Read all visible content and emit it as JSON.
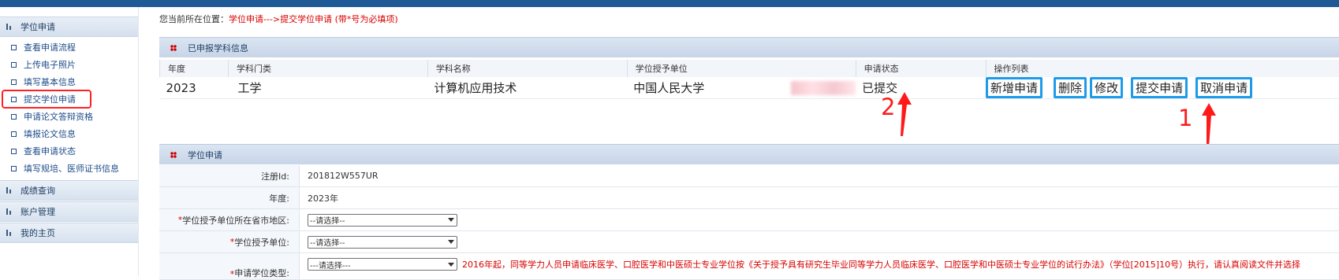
{
  "sidebar": {
    "header": "学位申请",
    "items": [
      {
        "label": "查看申请流程"
      },
      {
        "label": "上传电子照片"
      },
      {
        "label": "填写基本信息"
      },
      {
        "label": "提交学位申请"
      },
      {
        "label": "申请论文答辩资格"
      },
      {
        "label": "填报论文信息"
      },
      {
        "label": "查看申请状态"
      },
      {
        "label": "填写规培、医师证书信息"
      }
    ],
    "sections": [
      {
        "label": "成绩查询"
      },
      {
        "label": "账户管理"
      },
      {
        "label": "我的主页"
      }
    ]
  },
  "breadcrumb": {
    "prefix": "您当前所在位置：",
    "path": "学位申请--->提交学位申请 (带*号为必填项)"
  },
  "applied": {
    "title": "已申报学科信息",
    "headers": [
      "年度",
      "学科门类",
      "学科名称",
      "学位授予单位",
      "",
      "申请状态",
      "操作列表"
    ],
    "row": {
      "year": "2023",
      "category": "工学",
      "subject": "计算机应用技术",
      "unit": "中国人民大学",
      "status": "已提交"
    },
    "actions": [
      "新增申请",
      "删除",
      "修改",
      "提交申请",
      "取消申请"
    ]
  },
  "annotations": {
    "one": "1",
    "two": "2",
    "color": "#ff1a1a"
  },
  "apply_form": {
    "title": "学位申请",
    "reg_label": "注册Id:",
    "reg_value": "201812W557UR",
    "year_label": "年度:",
    "year_value": "2023年",
    "region_label": "学位授予单位所在省市地区:",
    "unit_label": "学位授予单位:",
    "type_label": "申请学位类型:",
    "placeholder": "--请选择--",
    "placeholder2": "---请选择---",
    "notice": "2016年起，同等学力人员申请临床医学、口腔医学和中医硕士专业学位按《关于授予具有研究生毕业同等学力人员临床医学、口腔医学和中医硕士专业学位的试行办法》（学位[2015]10号）执行，请认真阅读文件并选择"
  }
}
